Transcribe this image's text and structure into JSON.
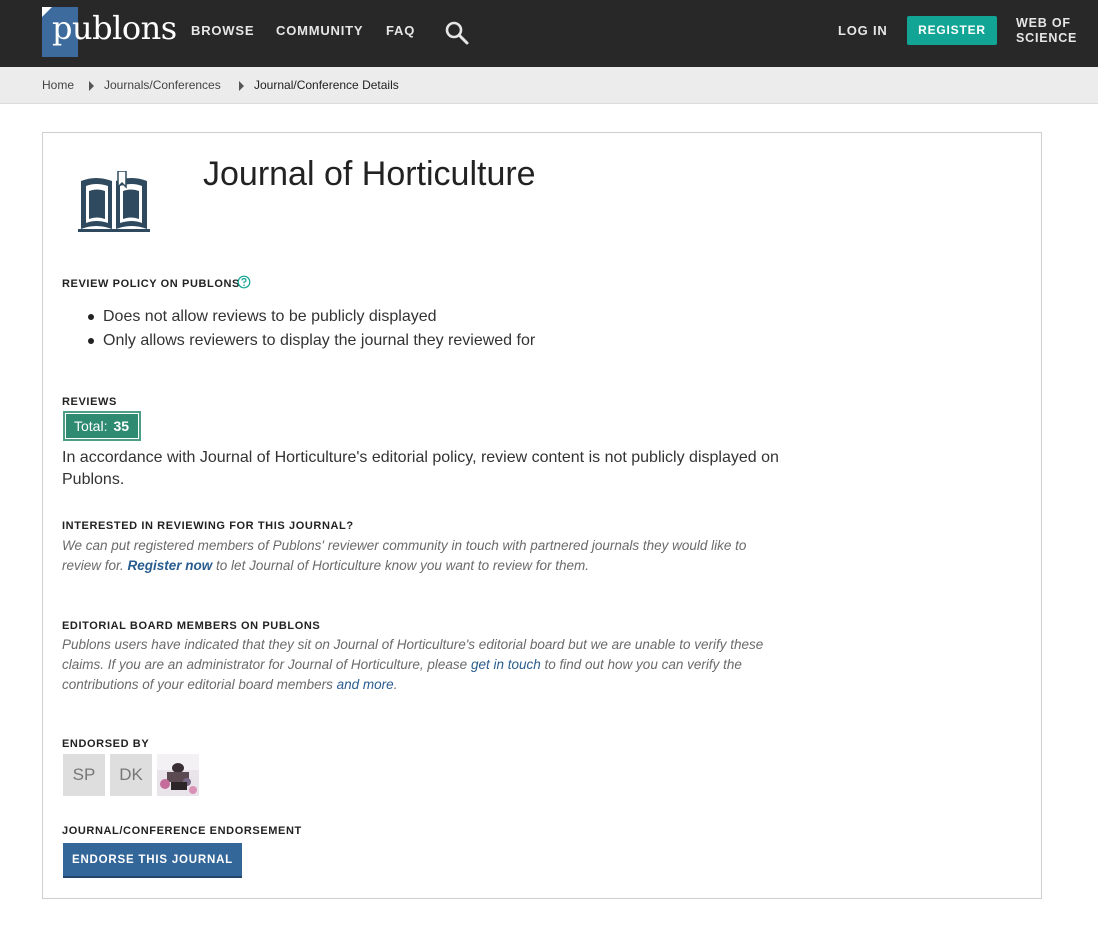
{
  "header": {
    "logo_text": "publons",
    "nav": [
      "BROWSE",
      "COMMUNITY",
      "FAQ"
    ],
    "login_label": "LOG IN",
    "register_label": "REGISTER",
    "wos_line1": "WEB OF",
    "wos_line2": "SCIENCE"
  },
  "breadcrumb": [
    "Home",
    "Journals/Conferences",
    "Journal/Conference Details"
  ],
  "journal": {
    "title": "Journal of Horticulture"
  },
  "review_policy": {
    "heading": "REVIEW POLICY ON PUBLONS",
    "items": [
      "Does not allow reviews to be publicly displayed",
      "Only allows reviewers to display the journal they reviewed for"
    ]
  },
  "reviews": {
    "heading": "REVIEWS",
    "total_label": "Total:",
    "total_value": "35",
    "note": "In accordance with Journal of Horticulture's editorial policy, review content is not publicly displayed on Publons."
  },
  "interested": {
    "heading": "INTERESTED IN REVIEWING FOR THIS JOURNAL?",
    "text_before": "We can put registered members of Publons' reviewer community in touch with partnered journals they would like to review for. ",
    "link": "Register now",
    "text_after": " to let Journal of Horticulture know you want to review for them."
  },
  "editorial": {
    "heading": "EDITORIAL BOARD MEMBERS ON PUBLONS",
    "text_before": "Publons users have indicated that they sit on Journal of Horticulture's editorial board but we are unable to verify these claims. If you are an administrator for Journal of Horticulture, please ",
    "link1": "get in touch",
    "text_middle": " to find out how you can verify the contributions of your editorial board members ",
    "link2": "and more",
    "text_end": "."
  },
  "endorsed_by": {
    "heading": "ENDORSED BY",
    "avatars": [
      "SP",
      "DK"
    ]
  },
  "endorsement": {
    "heading": "JOURNAL/CONFERENCE ENDORSEMENT",
    "button": "ENDORSE THIS JOURNAL"
  },
  "colors": {
    "topbar": "#282828",
    "register": "#12a596",
    "badge": "#2e8a71",
    "endorse_button": "#336699",
    "link": "#2a5d8f"
  }
}
